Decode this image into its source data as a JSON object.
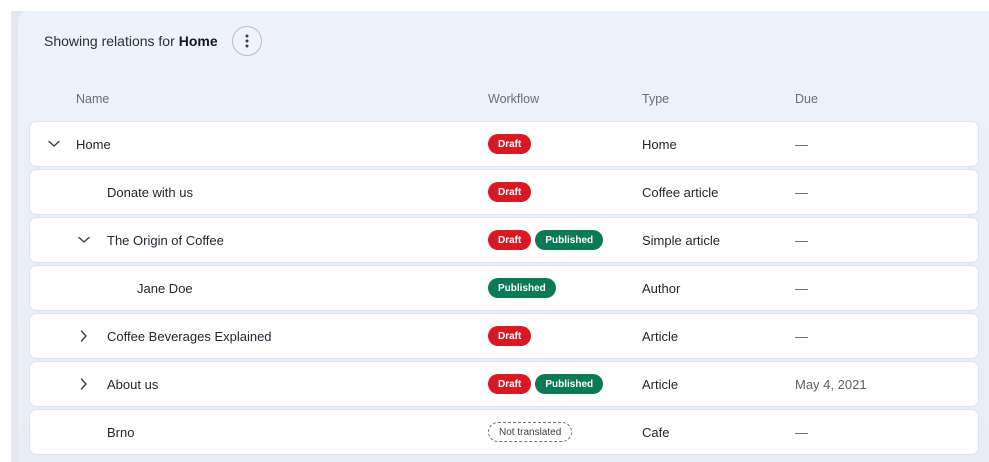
{
  "header": {
    "showing_label": "Showing relations for",
    "current_item": "Home"
  },
  "columns": {
    "name": "Name",
    "workflow": "Workflow",
    "type": "Type",
    "due": "Due"
  },
  "rows": [
    {
      "name": "Home",
      "expander": "expanded",
      "badges": [
        {
          "label": "Draft",
          "kind": "draft"
        }
      ],
      "type": "Home",
      "due": "—"
    },
    {
      "name": "Donate with us",
      "expander": "none",
      "badges": [
        {
          "label": "Draft",
          "kind": "draft"
        }
      ],
      "type": "Coffee article",
      "due": "—"
    },
    {
      "name": "The Origin of Coffee",
      "expander": "expanded",
      "badges": [
        {
          "label": "Draft",
          "kind": "draft"
        },
        {
          "label": "Published",
          "kind": "published"
        }
      ],
      "type": "Simple article",
      "due": "—"
    },
    {
      "name": "Jane Doe",
      "expander": "none",
      "badges": [
        {
          "label": "Published",
          "kind": "published"
        }
      ],
      "type": "Author",
      "due": "—"
    },
    {
      "name": "Coffee Beverages Explained",
      "expander": "collapsed",
      "badges": [
        {
          "label": "Draft",
          "kind": "draft"
        }
      ],
      "type": "Article",
      "due": "—"
    },
    {
      "name": "About us",
      "expander": "collapsed",
      "badges": [
        {
          "label": "Draft",
          "kind": "draft"
        },
        {
          "label": "Published",
          "kind": "published"
        }
      ],
      "type": "Article",
      "due": "May 4, 2021"
    },
    {
      "name": "Brno",
      "expander": "none",
      "badges": [
        {
          "label": "Not translated",
          "kind": "not-translated"
        }
      ],
      "type": "Cafe",
      "due": "—"
    }
  ],
  "colors": {
    "draft": "#d81921",
    "published": "#0c7a57",
    "background": "#eef2fa"
  },
  "icons": {
    "menu": "more-vertical-icon",
    "expanded": "chevron-down-icon",
    "collapsed": "chevron-right-icon"
  }
}
